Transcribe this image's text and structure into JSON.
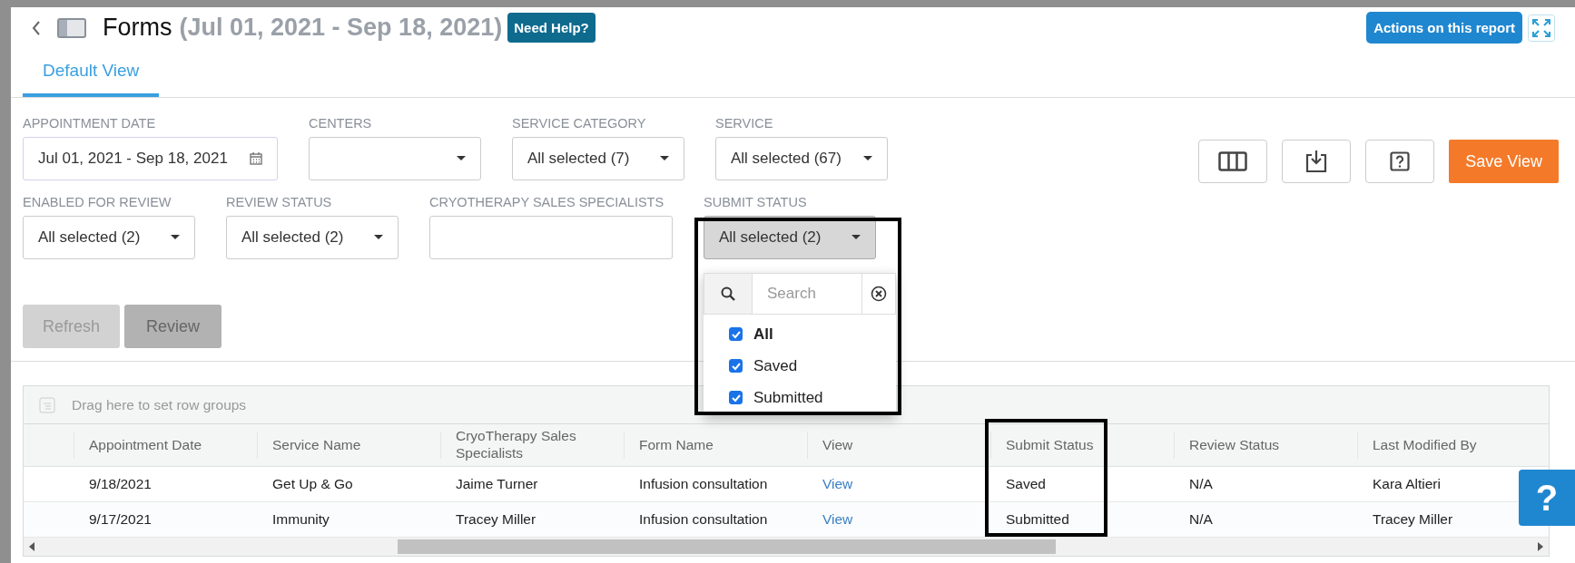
{
  "header": {
    "title": "Forms",
    "date_range": "(Jul 01, 2021 - Sep 18, 2021)",
    "help_button": "Need Help?",
    "actions_button": "Actions on this report"
  },
  "tabs": [
    {
      "label": "Default View",
      "selected": true
    }
  ],
  "filter_rows": [
    [
      {
        "label": "APPOINTMENT DATE",
        "value": "Jul 01, 2021 - Sep 18, 2021",
        "kind": "date"
      },
      {
        "label": "CENTERS",
        "kind": "select"
      },
      {
        "label": "SERVICE CATEGORY",
        "value": "All selected (7)",
        "kind": "select"
      },
      {
        "label": "SERVICE",
        "value": "All selected (67)",
        "kind": "select"
      }
    ],
    [
      {
        "label": "ENABLED FOR REVIEW",
        "value": "All selected (2)",
        "kind": "select"
      },
      {
        "label": "REVIEW STATUS",
        "value": "All selected (2)",
        "kind": "select"
      },
      {
        "label": "CRYOTHERAPY SALES SPECIALISTS",
        "kind": "text"
      },
      {
        "label": "SUBMIT STATUS",
        "value": "All selected (2)",
        "kind": "select",
        "expanded": true,
        "highlighted": true,
        "dropdown": {
          "search_placeholder": "Search",
          "options": [
            {
              "label": "All",
              "checked": true
            },
            {
              "label": "Saved",
              "checked": true
            },
            {
              "label": "Submitted",
              "checked": true
            }
          ]
        }
      }
    ]
  ],
  "save_button": "Save View",
  "actions": [
    {
      "label": "Refresh",
      "disabled": true
    },
    {
      "label": "Review",
      "disabled": false
    }
  ],
  "table": {
    "group_hint": "Drag here to set row groups",
    "columns": [
      {
        "label": "Appointment Date",
        "kind": "text"
      },
      {
        "label": "Service Name",
        "kind": "text"
      },
      {
        "label": "CryoTherapy Sales Specialists",
        "kind": "text"
      },
      {
        "label": "Form Name",
        "kind": "text"
      },
      {
        "label": "View",
        "kind": "link"
      },
      {
        "label": "Submit Status",
        "kind": "text",
        "highlighted": true
      },
      {
        "label": "Review Status",
        "kind": "text"
      },
      {
        "label": "Last Modified By",
        "kind": "text"
      }
    ],
    "rows": [
      [
        "9/18/2021",
        "Get Up & Go",
        "Jaime Turner",
        "Infusion consultation",
        "View",
        "Saved",
        "N/A",
        "Kara Altieri"
      ],
      [
        "9/17/2021",
        "Immunity",
        "Tracey Miller",
        "Infusion consultation",
        "View",
        "Submitted",
        "N/A",
        "Tracey Miller"
      ]
    ]
  },
  "help_float": "?"
}
